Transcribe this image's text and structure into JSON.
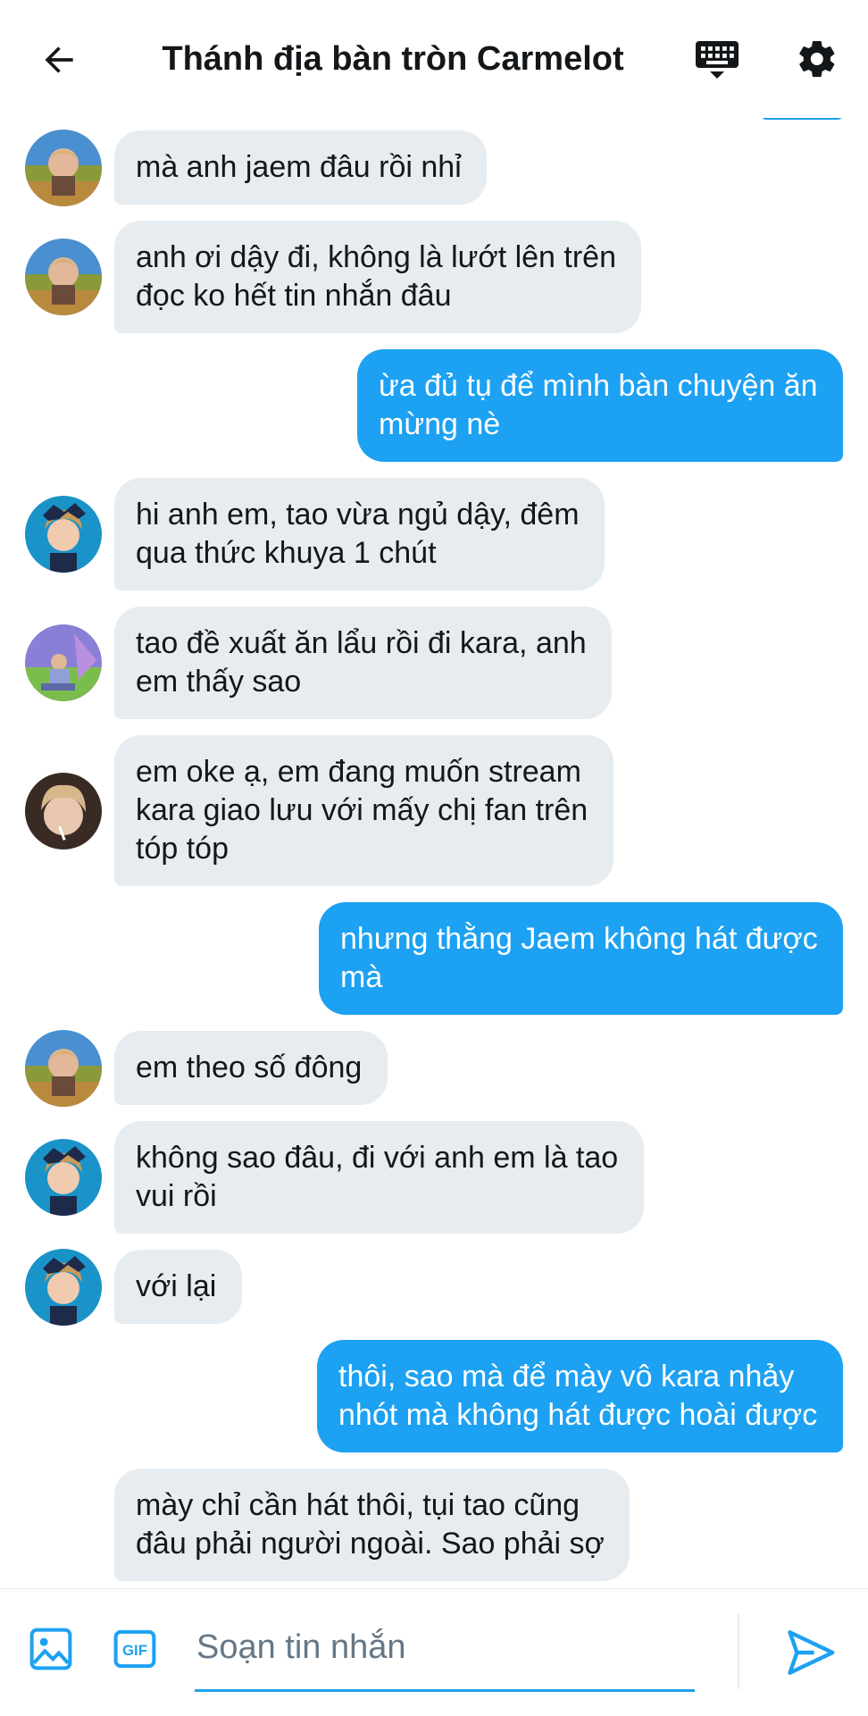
{
  "header": {
    "title": "Thánh địa bàn tròn Carmelot",
    "back_icon": "arrow-left-icon",
    "keyboard_icon": "keyboard-icon",
    "settings_icon": "gear-icon"
  },
  "colors": {
    "accent": "#1da1f2",
    "incoming_bubble": "#e6ecf0",
    "text": "#14171a"
  },
  "messages": [
    {
      "dir": "in",
      "avatar": "avatar-a",
      "lines": [
        "mà anh jaem đâu rồi nhỉ"
      ]
    },
    {
      "dir": "in",
      "avatar": "avatar-a",
      "lines": [
        "anh ơi dậy đi, không là lướt lên trên",
        "đọc ko hết tin nhắn đâu"
      ]
    },
    {
      "dir": "out",
      "lines": [
        "ừa đủ tụ để mình bàn chuyện ăn",
        "mừng nè"
      ]
    },
    {
      "dir": "in",
      "avatar": "avatar-b",
      "lines": [
        "hi anh em, tao vừa ngủ dậy, đêm",
        "qua thức khuya 1 chút"
      ]
    },
    {
      "dir": "in",
      "avatar": "avatar-c",
      "lines": [
        "tao đề xuất ăn lẩu rồi đi kara, anh",
        "em thấy sao"
      ]
    },
    {
      "dir": "in",
      "avatar": "avatar-d",
      "lines": [
        "em oke ạ, em đang muốn stream",
        "kara giao lưu với mấy chị fan trên",
        "tóp tóp"
      ]
    },
    {
      "dir": "out",
      "lines": [
        "nhưng thằng Jaem không hát được",
        "mà"
      ]
    },
    {
      "dir": "in",
      "avatar": "avatar-a",
      "lines": [
        "em theo số đông"
      ]
    },
    {
      "dir": "in",
      "avatar": "avatar-b",
      "lines": [
        "không sao đâu, đi với anh em là tao",
        "vui rồi"
      ]
    },
    {
      "dir": "in",
      "avatar": "avatar-b",
      "lines": [
        "với lại"
      ]
    },
    {
      "dir": "out",
      "lines": [
        "thôi, sao mà để mày vô kara nhảy",
        "nhót mà không hát được hoài được"
      ]
    },
    {
      "dir": "in",
      "lines": [
        "mày chỉ cần hát thôi, tụi tao cũng",
        "đâu phải người ngoài. Sao phải sợ"
      ]
    }
  ],
  "composer": {
    "placeholder": "Soạn tin nhắn",
    "value": "",
    "media_icon": "image-icon",
    "gif_label": "GIF",
    "send_icon": "send-icon"
  }
}
